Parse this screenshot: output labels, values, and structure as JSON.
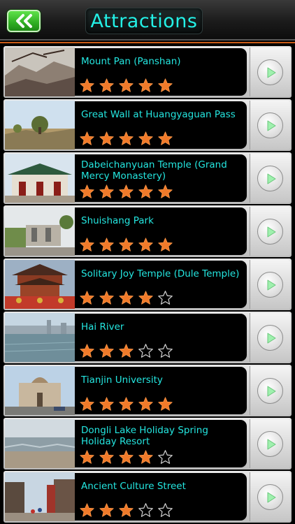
{
  "header": {
    "title": "Attractions",
    "back_icon": "double-chevron-left-icon"
  },
  "colors": {
    "accent_cyan": "#24e6e0",
    "star_orange": "#f07a2a",
    "back_green": "#2fae22",
    "header_divider": "#c95b16"
  },
  "attractions": [
    {
      "name": "Mount Pan (Panshan)",
      "rating": 5
    },
    {
      "name": "Great Wall at Huangyaguan Pass",
      "rating": 5
    },
    {
      "name": "Dabeichanyuan Temple (Grand Mercy Monastery)",
      "rating": 5
    },
    {
      "name": "Shuishang Park",
      "rating": 5
    },
    {
      "name": "Solitary Joy Temple (Dule Temple)",
      "rating": 4
    },
    {
      "name": "Hai River",
      "rating": 3
    },
    {
      "name": "Tianjin University",
      "rating": 5
    },
    {
      "name": "Dongli Lake Holiday Spring Holiday Resort",
      "rating": 4
    },
    {
      "name": "Ancient Culture Street",
      "rating": 3
    }
  ]
}
